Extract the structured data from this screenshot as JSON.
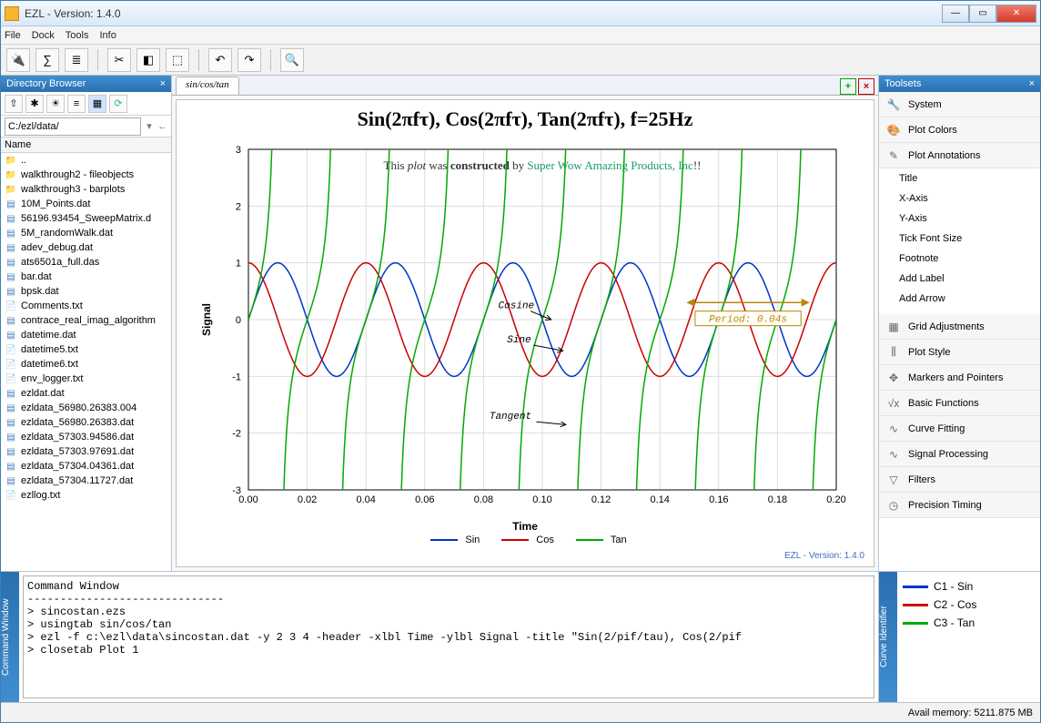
{
  "window": {
    "title": "EZL - Version: 1.4.0"
  },
  "menubar": [
    "File",
    "Dock",
    "Tools",
    "Info"
  ],
  "dir": {
    "panel_title": "Directory Browser",
    "path": "C:/ezl/data/",
    "header": "Name",
    "files": [
      {
        "icon": "folder",
        "name": ".."
      },
      {
        "icon": "folder",
        "name": "walkthrough2 - fileobjects"
      },
      {
        "icon": "folder",
        "name": "walkthrough3 - barplots"
      },
      {
        "icon": "dat",
        "name": "10M_Points.dat"
      },
      {
        "icon": "dat",
        "name": "56196.93454_SweepMatrix.d"
      },
      {
        "icon": "dat",
        "name": "5M_randomWalk.dat"
      },
      {
        "icon": "dat",
        "name": "adev_debug.dat"
      },
      {
        "icon": "dat",
        "name": "ats6501a_full.das"
      },
      {
        "icon": "dat",
        "name": "bar.dat"
      },
      {
        "icon": "dat",
        "name": "bpsk.dat"
      },
      {
        "icon": "txt",
        "name": "Comments.txt"
      },
      {
        "icon": "dat",
        "name": "contrace_real_imag_algorithm"
      },
      {
        "icon": "dat",
        "name": "datetime.dat"
      },
      {
        "icon": "txt",
        "name": "datetime5.txt"
      },
      {
        "icon": "txt",
        "name": "datetime6.txt"
      },
      {
        "icon": "txt",
        "name": "env_logger.txt"
      },
      {
        "icon": "dat",
        "name": "ezldat.dat"
      },
      {
        "icon": "dat",
        "name": "ezldata_56980.26383.004"
      },
      {
        "icon": "dat",
        "name": "ezldata_56980.26383.dat"
      },
      {
        "icon": "dat",
        "name": "ezldata_57303.94586.dat"
      },
      {
        "icon": "dat",
        "name": "ezldata_57303.97691.dat"
      },
      {
        "icon": "dat",
        "name": "ezldata_57304.04361.dat"
      },
      {
        "icon": "dat",
        "name": "ezldata_57304.11727.dat"
      },
      {
        "icon": "txt",
        "name": "ezllog.txt"
      }
    ]
  },
  "tab": {
    "label": "sin/cos/tan"
  },
  "toolsets": {
    "panel_title": "Toolsets",
    "groups": [
      "System",
      "Plot Colors",
      "Plot Annotations"
    ],
    "annotations_sub": [
      "Title",
      "X-Axis",
      "Y-Axis",
      "Tick Font Size",
      "Footnote",
      "Add Label",
      "Add Arrow"
    ],
    "groups2": [
      "Grid Adjustments",
      "Plot Style",
      "Markers and Pointers",
      "Basic Functions",
      "Curve Fitting",
      "Signal Processing",
      "Filters",
      "Precision Timing"
    ]
  },
  "cmd": {
    "tab_label": "Command Window",
    "lines": "Command Window\n------------------------------\n> sincostan.ezs\n> usingtab sin/cos/tan\n> ezl -f c:\\ezl\\data\\sincostan.dat -y 2 3 4 -header -xlbl Time -ylbl Signal -title \"Sin(2/pif/tau), Cos(2/pif\n> closetab Plot 1"
  },
  "curves": {
    "tab_label": "Curve Identifier",
    "items": [
      {
        "color": "#0033cc",
        "label": "C1 - Sin"
      },
      {
        "color": "#cc0000",
        "label": "C2 - Cos"
      },
      {
        "color": "#00aa00",
        "label": "C3 - Tan"
      }
    ]
  },
  "status": {
    "mem": "Avail memory: 5211.875 MB"
  },
  "chart_data": {
    "type": "line",
    "title": "Sin(2πfτ), Cos(2πfτ), Tan(2πfτ), f=25Hz",
    "subtitle_html": "This <i>plot</i> was <b>constructed</b> by <span class='co'>Super Wow Amazing Products, Inc</span>!!",
    "xlabel": "Time",
    "ylabel": "Signal",
    "xlim": [
      0.0,
      0.2
    ],
    "ylim": [
      -3,
      3
    ],
    "xticks": [
      0.0,
      0.02,
      0.04,
      0.06,
      0.08,
      0.1,
      0.12,
      0.14,
      0.16,
      0.18,
      0.2
    ],
    "yticks": [
      -3,
      -2,
      -1,
      0,
      1,
      2,
      3
    ],
    "period_label": "Period: 0.04s",
    "annotations": [
      "Cosine",
      "Sine",
      "Tangent"
    ],
    "footer": "EZL - Version: 1.4.0",
    "series": [
      {
        "name": "Sin",
        "color": "#0033cc",
        "fn": "sin",
        "freq": 25,
        "amp": 1,
        "phase": 0
      },
      {
        "name": "Cos",
        "color": "#cc0000",
        "fn": "cos",
        "freq": 25,
        "amp": 1,
        "phase": 0
      },
      {
        "name": "Tan",
        "color": "#00aa00",
        "fn": "tan",
        "freq": 25,
        "amp": 1,
        "phase": 0
      }
    ]
  }
}
